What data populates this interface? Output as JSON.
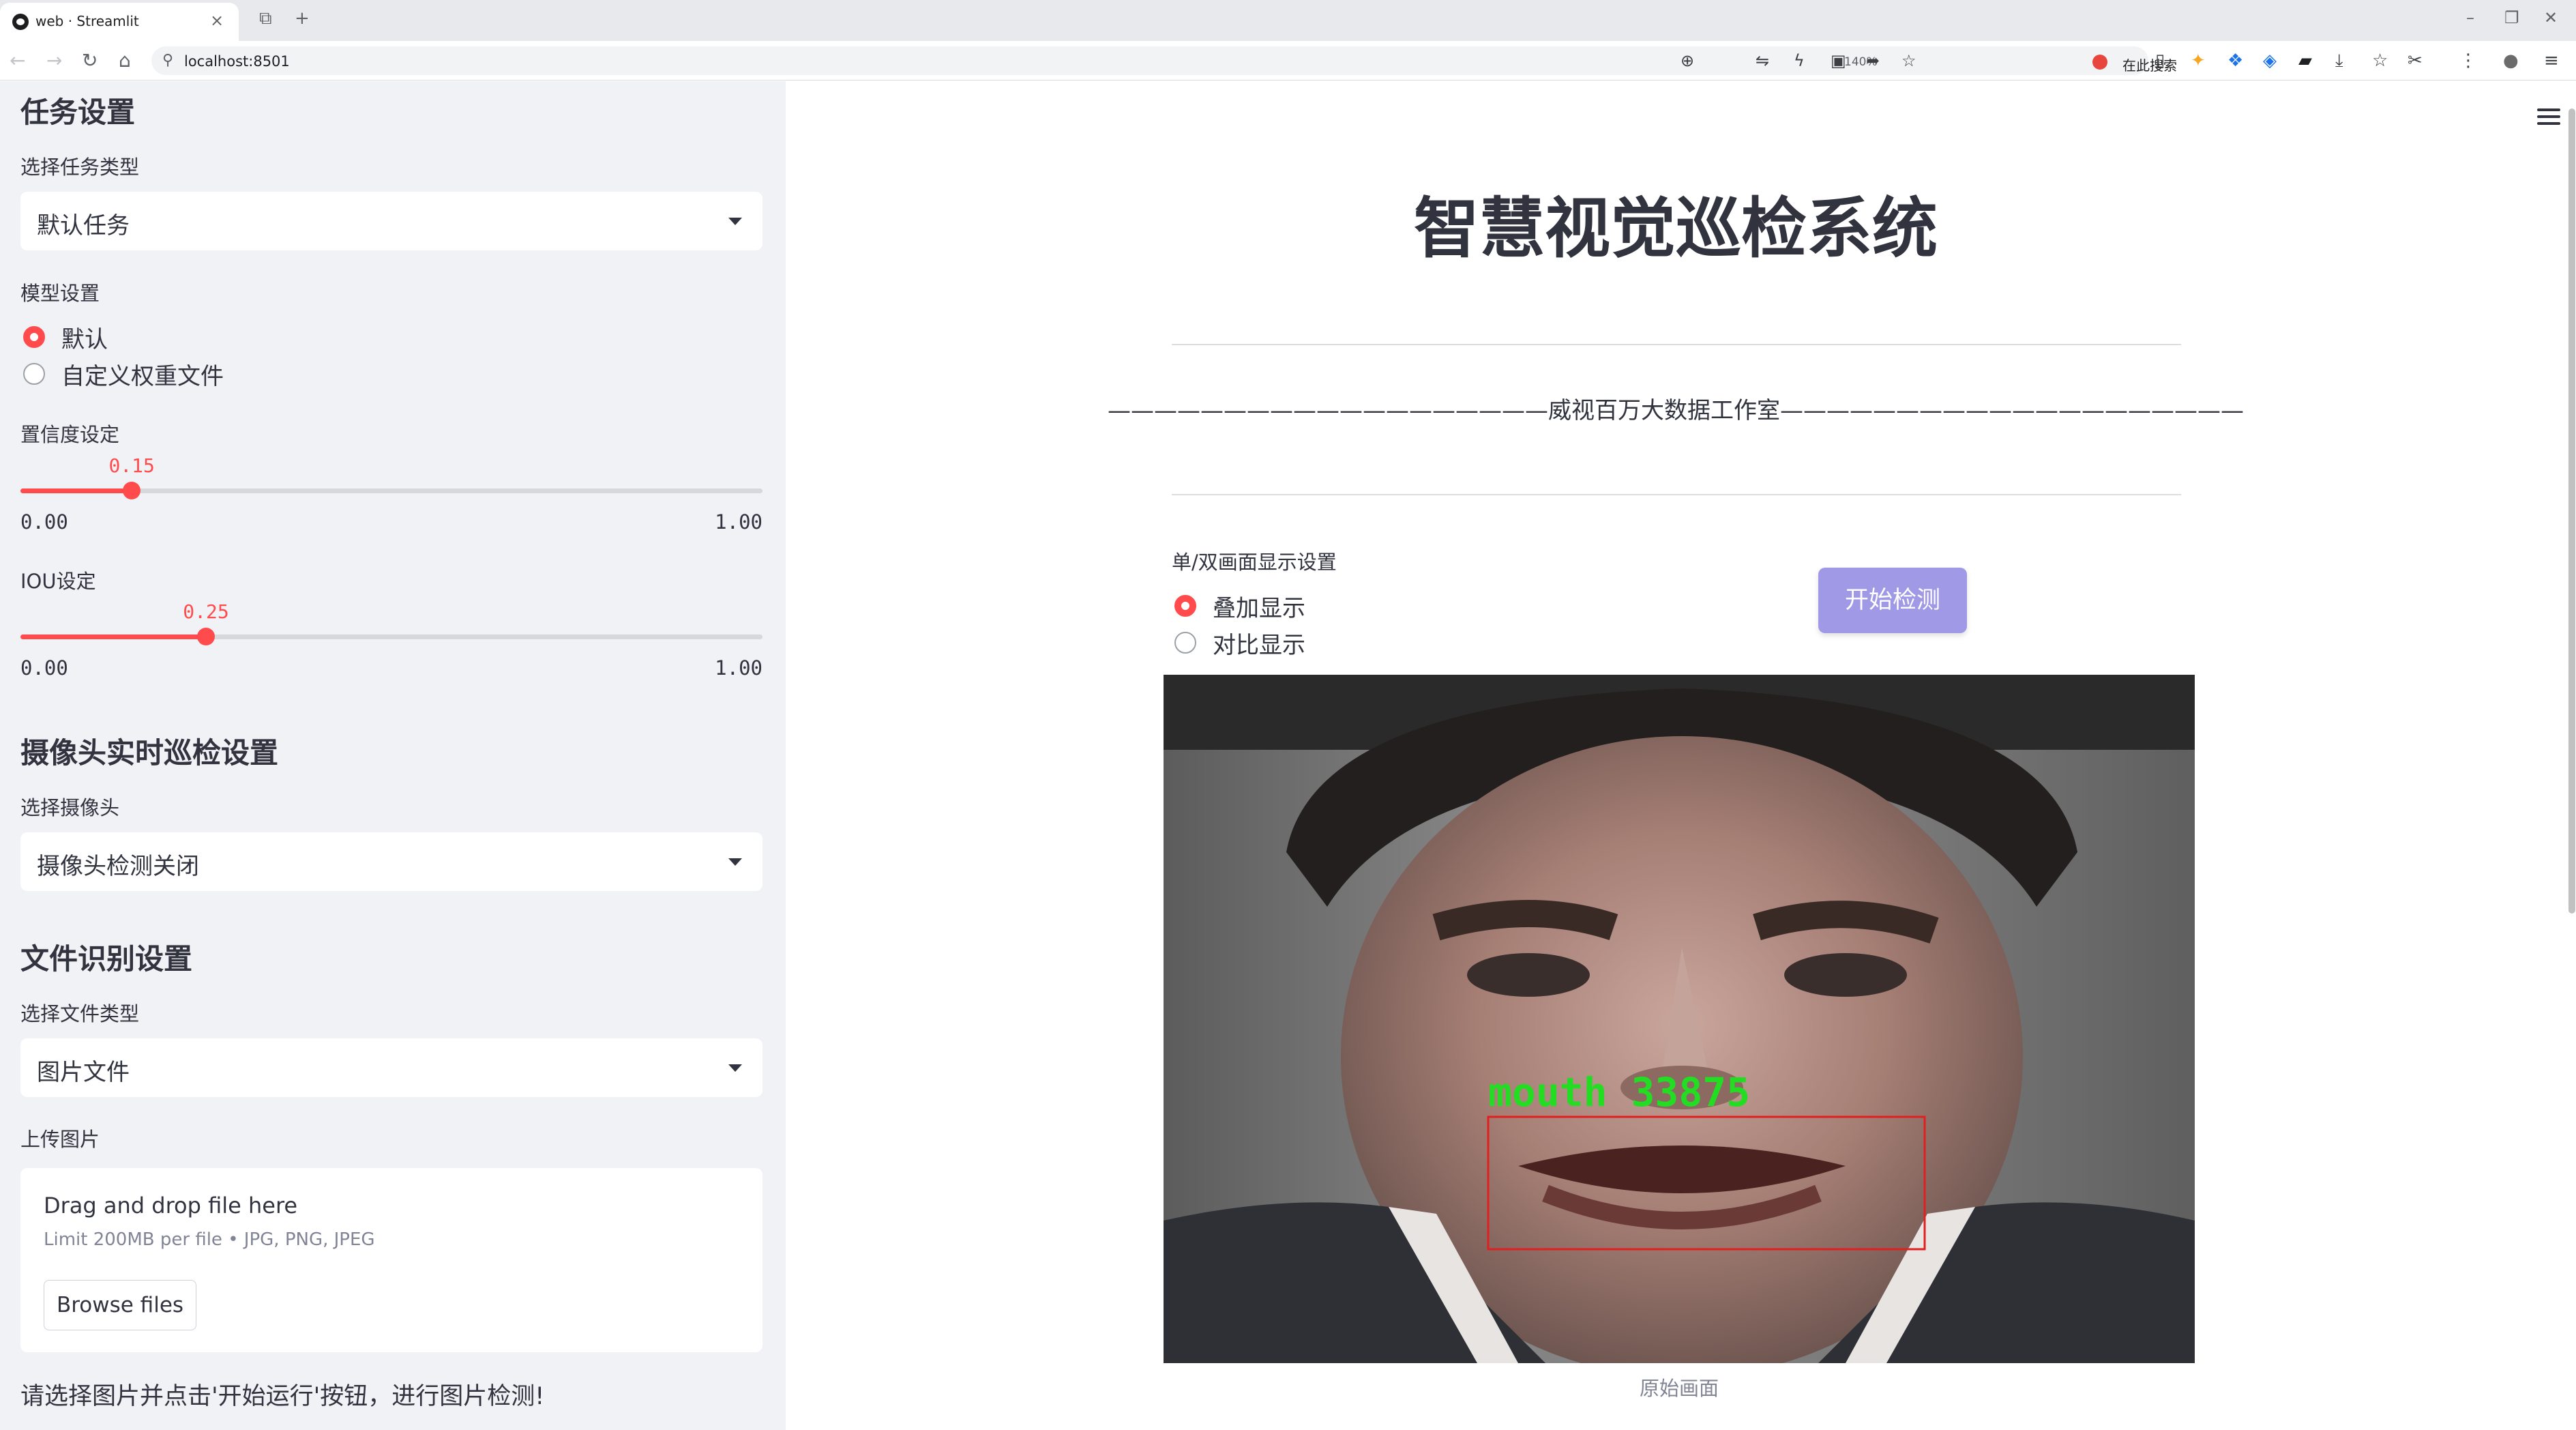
{
  "browser": {
    "tab_title": "web · Streamlit",
    "tab_close": "×",
    "new_tab": "+",
    "address": "localhost:8501",
    "zoom": "140%",
    "search_placeholder": "在此搜索",
    "window_controls": [
      "–",
      "❐",
      "✕"
    ]
  },
  "sidebar": {
    "task_section_title": "任务设置",
    "task_type_label": "选择任务类型",
    "task_type_value": "默认任务",
    "model_label": "模型设置",
    "model_options": [
      "默认",
      "自定义权重文件"
    ],
    "model_selected": 0,
    "confidence_label": "置信度设定",
    "confidence": {
      "value": 0.15,
      "value_text": "0.15",
      "min": "0.00",
      "max": "1.00"
    },
    "iou_label": "IOU设定",
    "iou": {
      "value": 0.25,
      "value_text": "0.25",
      "min": "0.00",
      "max": "1.00"
    },
    "camera_section_title": "摄像头实时巡检设置",
    "camera_label": "选择摄像头",
    "camera_value": "摄像头检测关闭",
    "file_section_title": "文件识别设置",
    "file_type_label": "选择文件类型",
    "file_type_value": "图片文件",
    "upload_label": "上传图片",
    "uploader": {
      "title": "Drag and drop file here",
      "hint": "Limit 200MB per file • JPG, PNG, JPEG",
      "button": "Browse files"
    },
    "tip": "请选择图片并点击'开始运行'按钮，进行图片检测!"
  },
  "main": {
    "title": "智慧视觉巡检系统",
    "studio_line": "———————————————————威视百万大数据工作室————————————————————",
    "display_label": "单/双画面显示设置",
    "display_options": [
      "叠加显示",
      "对比显示"
    ],
    "display_selected": 0,
    "start_button": "开始检测",
    "detection_label": "mouth 33875",
    "image_caption": "原始画面"
  },
  "colors": {
    "accent": "#ff4b4b",
    "sidebar_bg": "#f0f2f6",
    "button_bg": "#9f99e6",
    "detection_text": "#22dd22",
    "detection_box": "#e02020"
  }
}
